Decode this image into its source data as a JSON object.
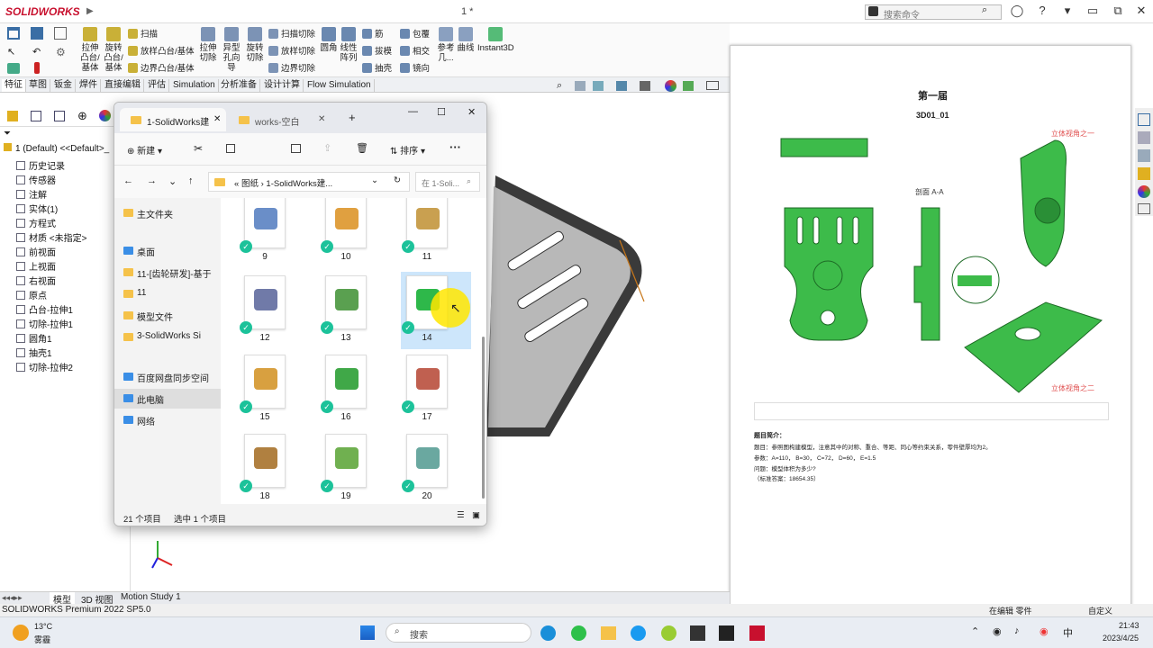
{
  "app": {
    "logo": "SOLIDWORKS",
    "doc_title": "1 *",
    "search_placeholder": "搜索命令"
  },
  "ribbon": {
    "big": [
      "拉伸凸台/基体",
      "旋转凸台/基体",
      "拉伸切除",
      "异型孔向导",
      "旋转切除",
      "圆角",
      "线性阵列",
      "参考几...",
      "曲线",
      "Instant3D"
    ],
    "small": [
      "扫描",
      "放样凸台/基体",
      "边界凸台/基体",
      "扫描切除",
      "放样切除",
      "边界切除",
      "筋",
      "拔模",
      "抽壳",
      "包覆",
      "相交",
      "镜向"
    ]
  },
  "tabs": [
    "特征",
    "草图",
    "钣金",
    "焊件",
    "直接编辑",
    "评估",
    "Simulation",
    "分析准备",
    "设计计算",
    "Flow Simulation"
  ],
  "tree": {
    "root": "1 (Default) <<Default>_",
    "items": [
      "历史记录",
      "传感器",
      "注解",
      "实体(1)",
      "方程式",
      "材质 <未指定>",
      "前视面",
      "上视面",
      "右视面",
      "原点",
      "凸台-拉伸1",
      "切除-拉伸1",
      "圆角1",
      "抽壳1",
      "切除-拉伸2"
    ]
  },
  "explorer": {
    "tab1": "1-SolidWorks建",
    "tab2": "works-空白",
    "new_label": "新建",
    "sort_label": "排序",
    "crumbs": [
      "图纸",
      "1-SolidWorks建..."
    ],
    "search_placeholder": "在 1-Soli...",
    "nav": [
      "主文件夹",
      "桌面",
      "11-[齿轮研发]-基于",
      "11",
      "模型文件",
      "3-SolidWorks Si",
      "百度网盘同步空间",
      "此电脑",
      "网络"
    ],
    "thumbs": [
      "9",
      "10",
      "11",
      "12",
      "13",
      "14",
      "15",
      "16",
      "17",
      "18",
      "19",
      "20"
    ],
    "count": "21 个项目",
    "selected": "选中 1 个项目"
  },
  "doc": {
    "title": "第一届",
    "code": "3D01_01",
    "view1": "立体视角之一",
    "view2": "立体视角之二",
    "section": "剖面 A-A",
    "intro_head": "题目简介：",
    "intro": "题目：参照图构建模型，注意其中的对称、重合、等距、同心等约束关系，零件壁厚均为2。",
    "params": "参数：A=110， B=30， C=72， D=60， E=1.5",
    "question": "问题：模型体积为多少?",
    "answer": "（标准答案：18654.35）"
  },
  "bottom_tabs": [
    "模型",
    "3D 视图",
    "Motion Study 1"
  ],
  "status": "SOLIDWORKS Premium 2022 SP5.0",
  "status_right": [
    "在编辑 零件",
    "自定义"
  ],
  "taskbar": {
    "weather_temp": "13°C",
    "weather_desc": "雾霾",
    "search": "搜索",
    "time": "21:43",
    "date": "2023/4/25"
  },
  "colors": {
    "accent": "#0067c0",
    "model_green": "#3dbb4a",
    "check": "#1cc29a",
    "view_label": "#e05050"
  }
}
